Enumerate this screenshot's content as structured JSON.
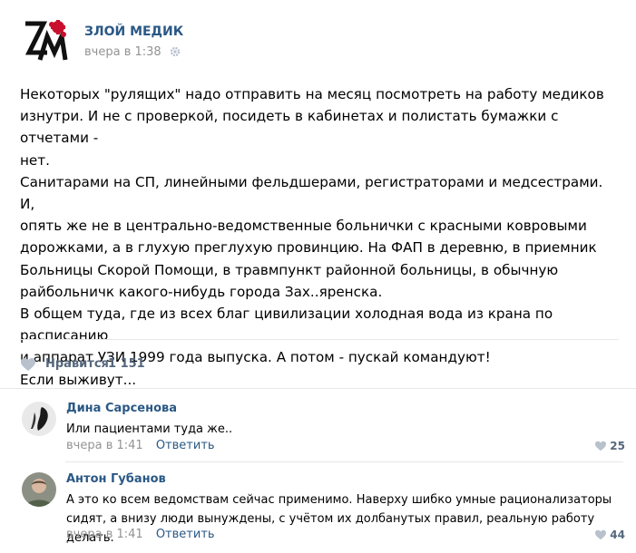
{
  "post": {
    "author": "ЗЛОЙ МЕДИК",
    "date": "вчера в 1:38",
    "text": "Некоторых \"рулящих\" надо отправить на месяц посмотреть на работу медиков\nизнутри. И не с проверкой, посидеть в кабинетах и полистать бумажки с отчетами -\nнет.\nСанитарами на СП, линейными фельдшерами, регистраторами и медсестрами. И,\nопять же не в центрально-ведомственные больнички с красными ковровыми\nдорожками, а в глухую преглухую провинцию. На ФАП в деревню, в приемник\nБольницы Скорой Помощи, в травмпункт районной больницы, в обычную\nрайбольничк какого-нибудь города Зах..яренска.\nВ общем туда, где из всех благ цивилизации холодная вода из крана по расписанию\nи аппарат УЗИ 1999 года выпуска. А потом - пускай командуют!\nЕсли выживут...",
    "like_label": "Нравится",
    "like_count": "1 151"
  },
  "comments": [
    {
      "author": "Дина Сарсенова",
      "text": "Или пациентами туда же..",
      "date": "вчера в 1:41",
      "reply": "Ответить",
      "likes": "25"
    },
    {
      "author": "Антон Губанов",
      "text": "А это ко всем ведомствам сейчас применимо. Наверху шибко умные рационализаторы\nсидят, а внизу люди вынуждены, с учётом их долбанутых правил, реальную работу делать.",
      "date": "вчера в 1:41",
      "reply": "Ответить",
      "likes": "44"
    }
  ],
  "colors": {
    "link": "#2a5885",
    "meta": "#939393",
    "logo_accent": "#c8102e"
  },
  "icons": [
    "logo-zm",
    "gear-icon",
    "heart-icon"
  ]
}
